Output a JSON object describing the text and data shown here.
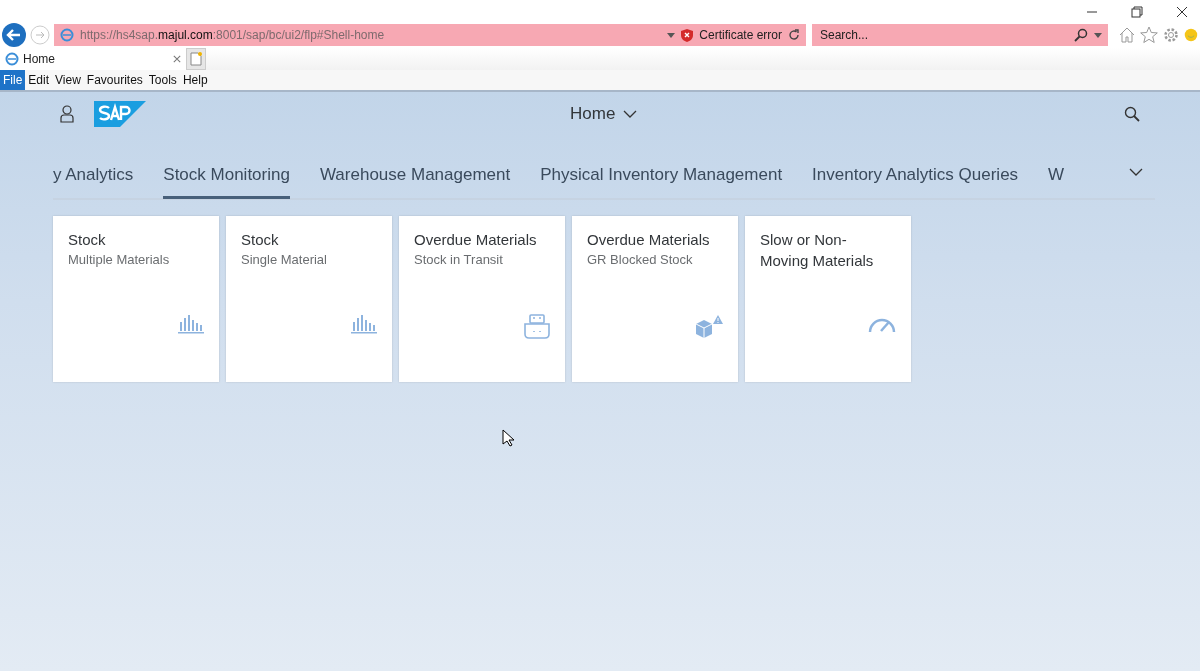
{
  "browser": {
    "url": "https://hs4sap.**majul.com**:8001/sap/bc/ui2/flp#Shell-home",
    "certificate": "Certificate error",
    "search": {
      "placeholder": "Search..."
    },
    "tab": "Home",
    "menu": [
      {
        "label": "File",
        "selected": true
      },
      {
        "label": "Edit",
        "selected": false
      },
      {
        "label": "View",
        "selected": false
      },
      {
        "label": "Favourites",
        "selected": false
      },
      {
        "label": "Tools",
        "selected": false
      },
      {
        "label": "Help",
        "selected": false
      }
    ]
  },
  "shell": {
    "title": "Home"
  },
  "tabs": [
    {
      "label": "y Analytics",
      "selected": false
    },
    {
      "label": "Stock Monitoring",
      "selected": true
    },
    {
      "label": "Warehouse Management",
      "selected": false
    },
    {
      "label": "Physical Inventory Management",
      "selected": false
    },
    {
      "label": "Inventory Analytics Queries",
      "selected": false
    },
    {
      "label": "W",
      "selected": false
    }
  ],
  "tiles": [
    {
      "title": "Stock",
      "subtitle": "Multiple Materials",
      "kind": "bars"
    },
    {
      "title": "Stock",
      "subtitle": "Single Material",
      "kind": "bars"
    },
    {
      "title": "Overdue Materials",
      "subtitle": "Stock in Transit",
      "kind": "ship"
    },
    {
      "title": "Overdue Materials",
      "subtitle": "GR Blocked Stock",
      "kind": "box-warning"
    },
    {
      "title": "Slow or Non-Moving Materials",
      "kind": "gauge"
    }
  ]
}
